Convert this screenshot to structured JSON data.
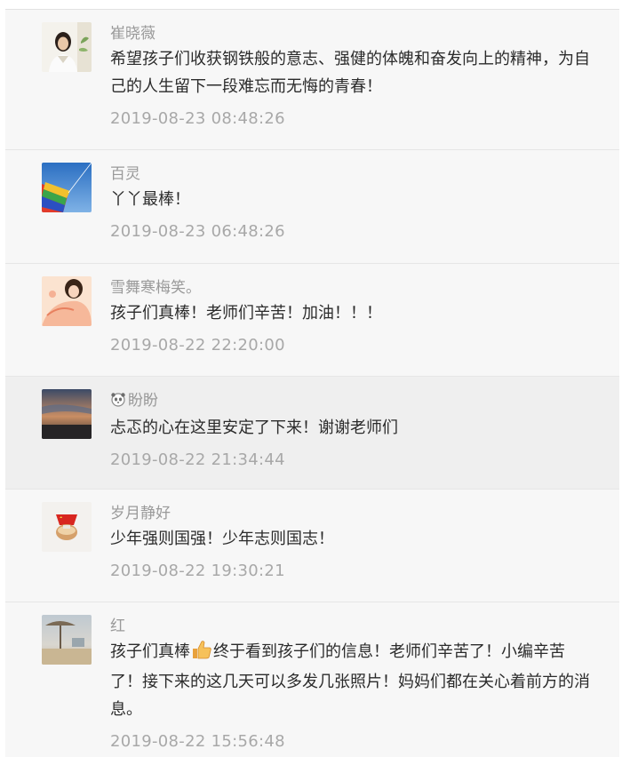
{
  "comments": [
    {
      "nickname": "崔晓薇",
      "avatar": "woman-portrait-avatar",
      "content": "希望孩子们收获钢铁般的意志、强健的体魄和奋发向上的精神，为自己的人生留下一段难忘而无悔的青春！",
      "time": "2019-08-23 08:48:26"
    },
    {
      "nickname": "百灵",
      "avatar": "rainbow-kite-avatar",
      "content": "丫丫最棒！",
      "time": "2019-08-23 06:48:26"
    },
    {
      "nickname": "雪舞寒梅笑。",
      "avatar": "illustrated-girl-avatar",
      "content": "孩子们真棒！老师们辛苦！加油！！！",
      "time": "2019-08-22 22:20:00"
    },
    {
      "nickname": "盼盼",
      "nickname_badge": "panda-icon",
      "avatar": "sunset-sky-avatar",
      "content": "忐忑的心在这里安定了下来！谢谢老师们",
      "time": "2019-08-22 21:34:44"
    },
    {
      "nickname": "岁月静好",
      "avatar": "red-flag-cup-avatar",
      "content": "少年强则国强！少年志则国志！",
      "time": "2019-08-22 19:30:21"
    },
    {
      "nickname": "红",
      "avatar": "beach-umbrella-avatar",
      "content_before": "孩子们真棒",
      "content_emoji": "thumbs-up-icon",
      "content_after": "终于看到孩子们的信息！老师们辛苦了！小编辛苦了！接下来的这几天可以多发几张照片！妈妈们都在关心着前方的消息。",
      "time": "2019-08-22 15:56:48"
    }
  ],
  "colors": {
    "background": "#f7f7f7",
    "highlight_row": "#efefef",
    "nickname": "#9a9a9a",
    "content": "#2b2b2b",
    "time": "#a8a8a8",
    "divider": "#e6e6e6"
  }
}
